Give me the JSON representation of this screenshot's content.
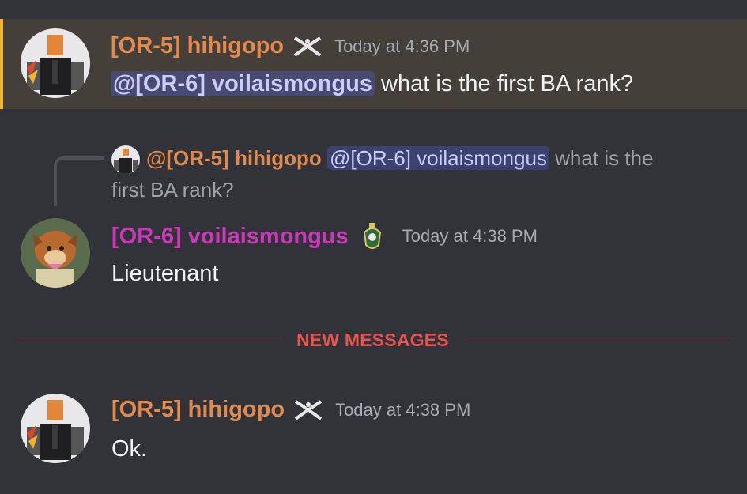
{
  "messages": [
    {
      "username": "[OR-5] hihigopo",
      "timestamp": "Today at 4:36 PM",
      "mention": "@[OR-6] voilaismongus",
      "text": "what is the first BA rank?",
      "role_icon": "crossed-kukri-icon",
      "mentioned_highlight": "#f0b232"
    },
    {
      "reply": {
        "username": "@[OR-5] hihigopo",
        "mention": "@[OR-6] voilaismongus",
        "text_part1": " what is the",
        "text_part2": "first BA rank?"
      },
      "username": "[OR-6] voilaismongus",
      "timestamp": "Today at 4:38 PM",
      "text": "Lieutenant",
      "role_icon": "medical-corps-badge-icon"
    },
    {
      "username": "[OR-5] hihigopo",
      "timestamp": "Today at 4:38 PM",
      "text": "Ok.",
      "role_icon": "crossed-kukri-icon"
    }
  ],
  "divider": {
    "label": "NEW MESSAGES",
    "color": "#e8534f"
  },
  "colors": {
    "background": "#313338",
    "orange_user": "#e08a4f",
    "pink_user": "#c93ab8"
  }
}
